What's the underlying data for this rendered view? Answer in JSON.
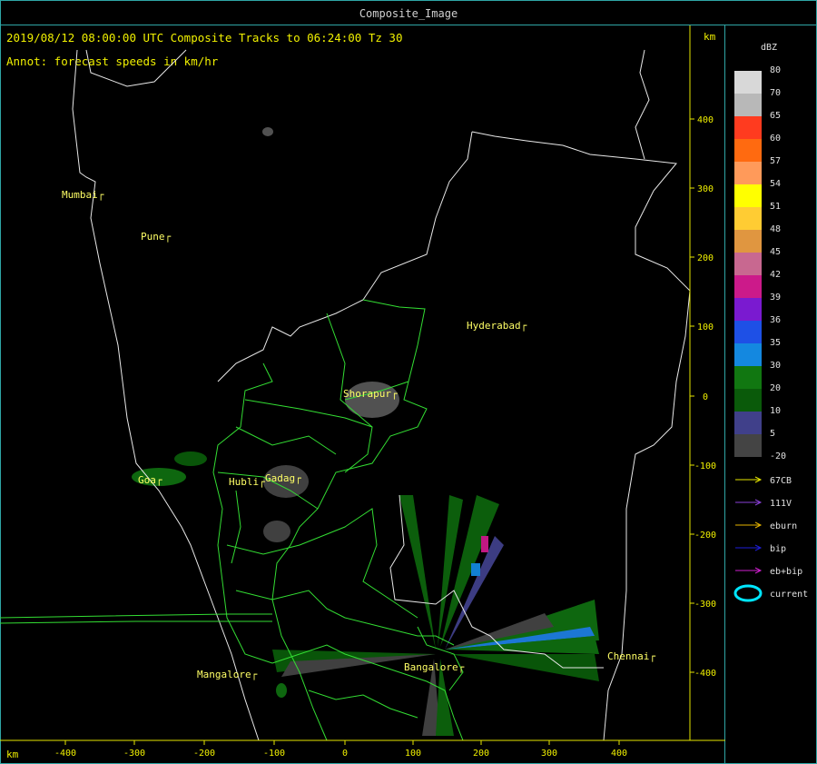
{
  "window": {
    "title": "Composite_Image"
  },
  "header": {
    "line1": "2019/08/12 08:00:00 UTC Composite Tracks to 06:24:00 Tz 30",
    "line2": "Annot: forecast speeds in km/hr",
    "km_top": "km",
    "km_bottom": "km"
  },
  "axes": {
    "x_ticks": [
      "-400",
      "-300",
      "-200",
      "-100",
      "0",
      "100",
      "200",
      "300",
      "400"
    ],
    "y_ticks": [
      "400",
      "300",
      "200",
      "100",
      "0",
      "-100",
      "-200",
      "-300",
      "-400"
    ]
  },
  "cities": [
    {
      "name": "Mumbai"
    },
    {
      "name": "Pune"
    },
    {
      "name": "Hyderabad"
    },
    {
      "name": "Shorapur"
    },
    {
      "name": "Goa"
    },
    {
      "name": "Hubli"
    },
    {
      "name": "Gadag"
    },
    {
      "name": "Mangalore"
    },
    {
      "name": "Bangalore"
    },
    {
      "name": "Chennai"
    }
  ],
  "legend": {
    "unit": "dBZ",
    "entries": [
      {
        "value": "80",
        "color": "#d8d8d8"
      },
      {
        "value": "70",
        "color": "#b8b8b8"
      },
      {
        "value": "65",
        "color": "#ff3b1f"
      },
      {
        "value": "60",
        "color": "#ff6a10"
      },
      {
        "value": "57",
        "color": "#ff9a5a"
      },
      {
        "value": "54",
        "color": "#ffff00"
      },
      {
        "value": "51",
        "color": "#ffcc33"
      },
      {
        "value": "48",
        "color": "#e09640"
      },
      {
        "value": "45",
        "color": "#c86890"
      },
      {
        "value": "42",
        "color": "#cc1a8a"
      },
      {
        "value": "39",
        "color": "#7a1ad0"
      },
      {
        "value": "36",
        "color": "#1e50e6"
      },
      {
        "value": "35",
        "color": "#1488e0"
      },
      {
        "value": "30",
        "color": "#117711"
      },
      {
        "value": "20",
        "color": "#0a5a0a"
      },
      {
        "value": "10",
        "color": "#40408a"
      },
      {
        "value": "5",
        "color": "#444444"
      },
      {
        "value": "-20",
        "color": "#000000"
      }
    ],
    "tracks": [
      {
        "label": "67CB",
        "color": "#e6e600"
      },
      {
        "label": "111V",
        "color": "#8a40d8"
      },
      {
        "label": "eburn",
        "color": "#e6b400"
      },
      {
        "label": "bip",
        "color": "#1e1ed8"
      },
      {
        "label": "eb+bip",
        "color": "#d020d0"
      },
      {
        "label": "current",
        "color": "#00e6ff"
      }
    ]
  }
}
